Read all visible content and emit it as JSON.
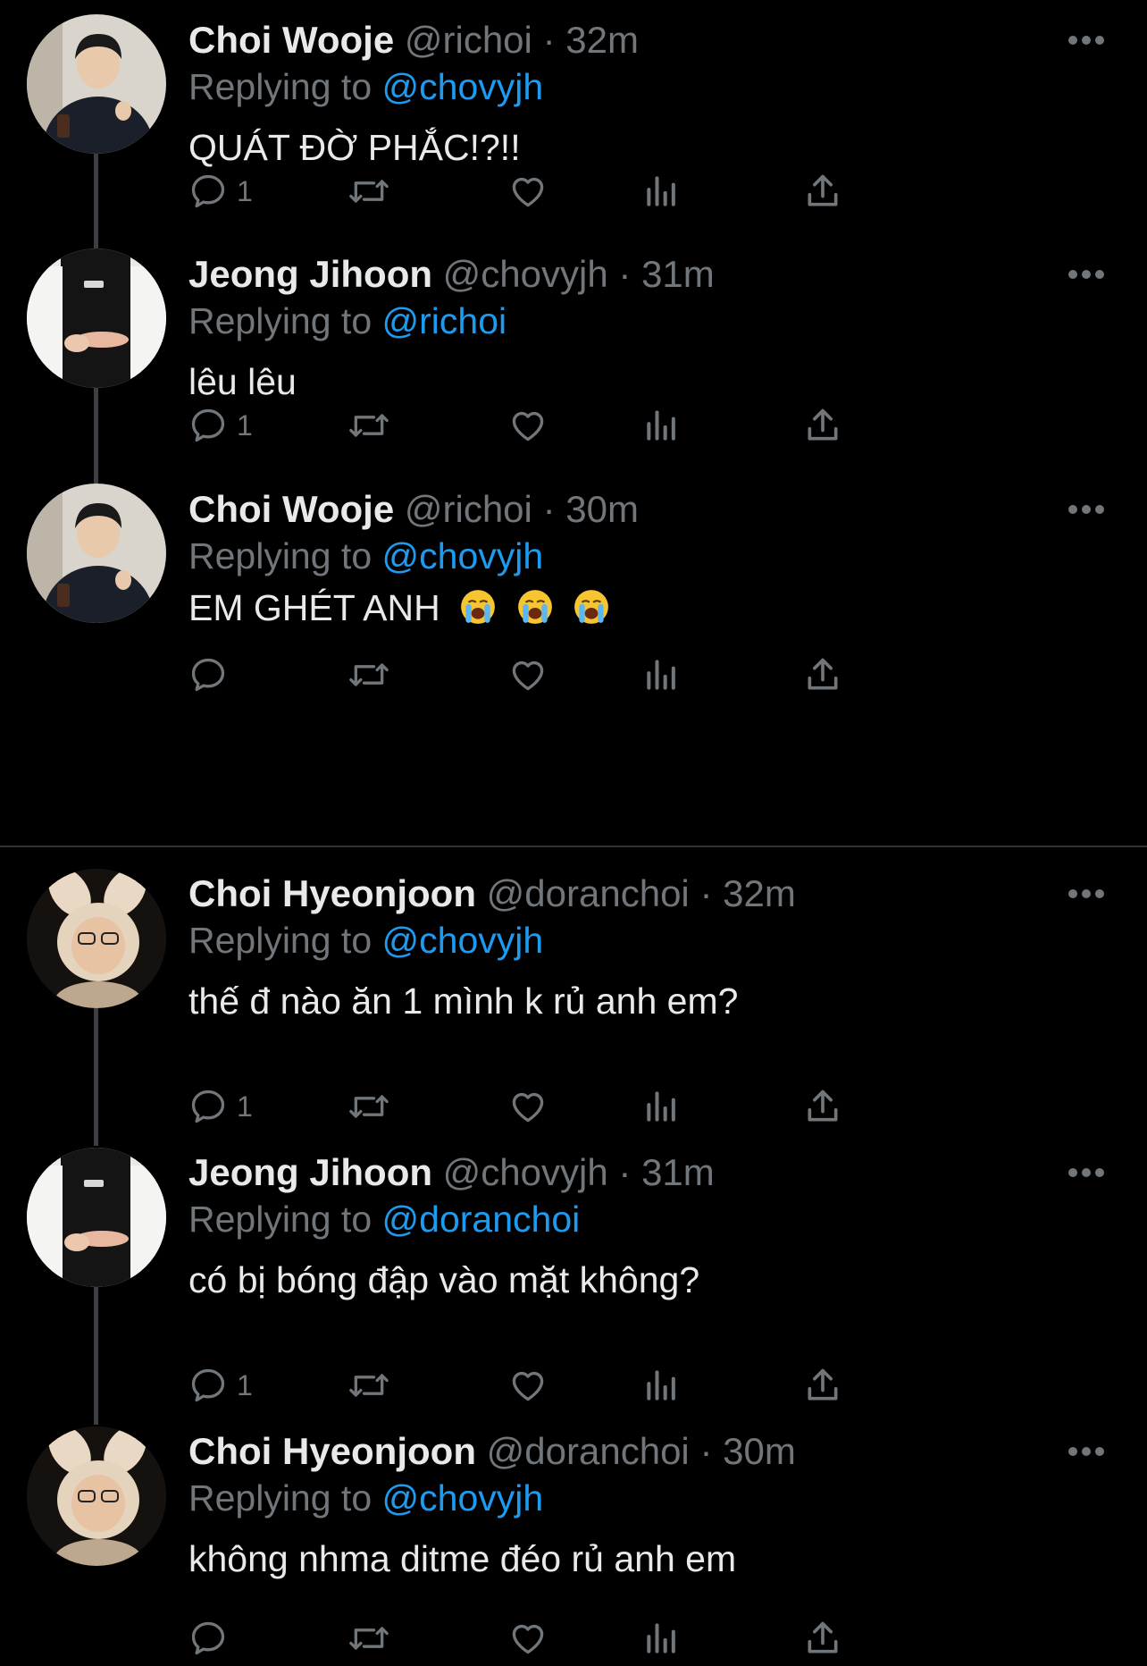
{
  "threads": [
    {
      "tweets": [
        {
          "avatar": "avatar-choi-wooje",
          "name": "Choi Wooje",
          "handle": "@richoi",
          "dot": "·",
          "time": "32m",
          "replying_label": "Replying to",
          "replying_to": "@chovyjh",
          "text": "QUÁT ĐỜ PHẮC!?!!",
          "reply_count": "1"
        },
        {
          "avatar": "avatar-jeong-jihoon",
          "name": "Jeong Jihoon",
          "handle": "@chovyjh",
          "dot": "·",
          "time": "31m",
          "replying_label": "Replying to",
          "replying_to": "@richoi",
          "text": "lêu lêu",
          "reply_count": "1"
        },
        {
          "avatar": "avatar-choi-wooje",
          "name": "Choi Wooje",
          "handle": "@richoi",
          "dot": "·",
          "time": "30m",
          "replying_label": "Replying to",
          "replying_to": "@chovyjh",
          "text": "EM GHÉT ANH",
          "emojis": [
            "loudly-crying-face",
            "loudly-crying-face",
            "loudly-crying-face"
          ],
          "reply_count": ""
        }
      ]
    },
    {
      "tweets": [
        {
          "avatar": "avatar-choi-hyeonjoon",
          "name": "Choi Hyeonjoon",
          "handle": "@doranchoi",
          "dot": "·",
          "time": "32m",
          "replying_label": "Replying to",
          "replying_to": "@chovyjh",
          "text": "thế đ nào ăn 1 mình k rủ anh em?",
          "reply_count": "1"
        },
        {
          "avatar": "avatar-jeong-jihoon",
          "name": "Jeong Jihoon",
          "handle": "@chovyjh",
          "dot": "·",
          "time": "31m",
          "replying_label": "Replying to",
          "replying_to": "@doranchoi",
          "text": "có bị bóng đập vào mặt không?",
          "reply_count": "1"
        },
        {
          "avatar": "avatar-choi-hyeonjoon",
          "name": "Choi Hyeonjoon",
          "handle": "@doranchoi",
          "dot": "·",
          "time": "30m",
          "replying_label": "Replying to",
          "replying_to": "@chovyjh",
          "text": "không nhma ditme đéo rủ anh em",
          "reply_count": ""
        }
      ]
    }
  ],
  "icons": {
    "reply": "reply-icon",
    "retweet": "retweet-icon",
    "like": "like-icon",
    "views": "views-icon",
    "share": "share-icon",
    "more": "more-icon"
  },
  "colors": {
    "background": "#000000",
    "primary_text": "#e7e9ea",
    "secondary_text": "#71767b",
    "accent": "#1d9bf0",
    "connector": "#3b3f44",
    "divider": "#2f3336"
  }
}
